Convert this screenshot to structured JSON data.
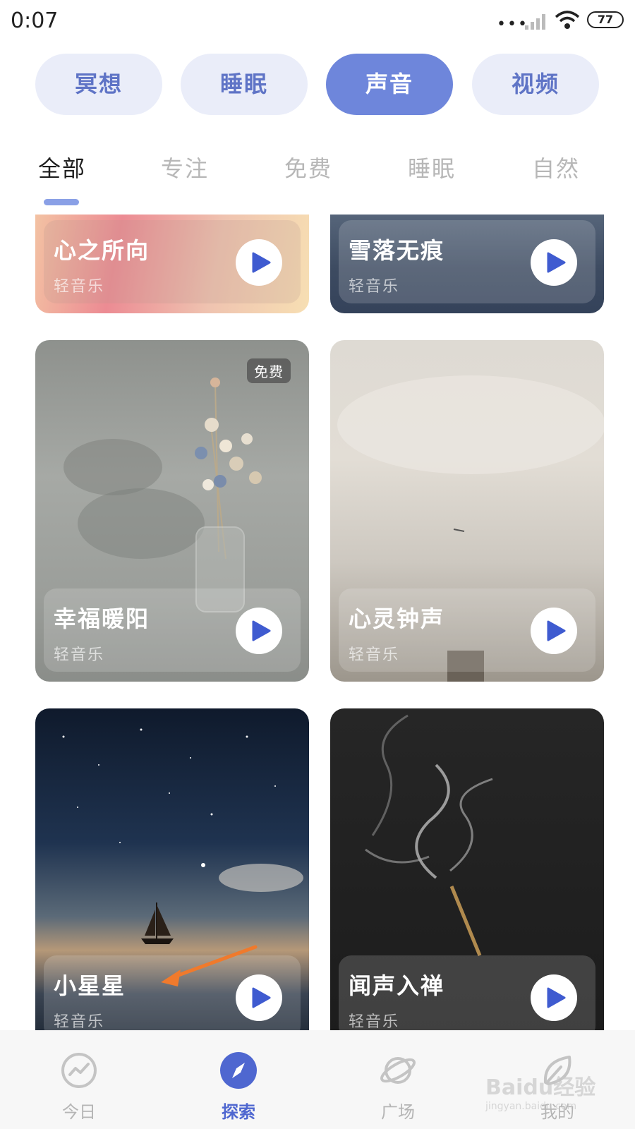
{
  "status_bar": {
    "time": "0:07",
    "battery": "77"
  },
  "categories": [
    {
      "label": "冥想",
      "active": false
    },
    {
      "label": "睡眠",
      "active": false
    },
    {
      "label": "声音",
      "active": true
    },
    {
      "label": "视频",
      "active": false
    }
  ],
  "subtabs": [
    {
      "label": "全部",
      "active": true
    },
    {
      "label": "专注",
      "active": false
    },
    {
      "label": "免费",
      "active": false
    },
    {
      "label": "睡眠",
      "active": false
    },
    {
      "label": "自然",
      "active": false
    }
  ],
  "cards": [
    {
      "title": "心之所向",
      "subtitle": "轻音乐"
    },
    {
      "title": "雪落无痕",
      "subtitle": "轻音乐"
    },
    {
      "title": "幸福暖阳",
      "subtitle": "轻音乐",
      "badge": "免费"
    },
    {
      "title": "心灵钟声",
      "subtitle": "轻音乐"
    },
    {
      "title": "小星星",
      "subtitle": "轻音乐"
    },
    {
      "title": "闻声入禅",
      "subtitle": "轻音乐"
    }
  ],
  "bottom_nav": [
    {
      "label": "今日",
      "icon": "trend-icon",
      "active": false
    },
    {
      "label": "探索",
      "icon": "compass-icon",
      "active": true
    },
    {
      "label": "广场",
      "icon": "planet-icon",
      "active": false
    },
    {
      "label": "我的",
      "icon": "leaf-icon",
      "active": false
    }
  ],
  "watermark": {
    "text": "Baidu经验",
    "url": "jingyan.baidu.com"
  },
  "colors": {
    "accent": "#6e86db",
    "pill_bg": "#eaedf9",
    "pill_text": "#5f74c6",
    "play_icon": "#3f5bd0",
    "nav_active": "#4f67d0"
  }
}
